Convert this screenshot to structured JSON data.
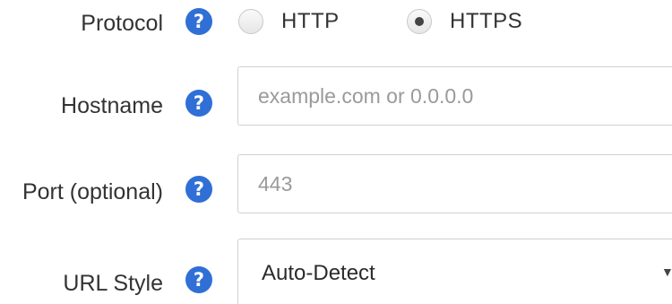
{
  "form": {
    "protocol": {
      "label": "Protocol",
      "help_icon": "question-circle-icon",
      "options": [
        {
          "label": "HTTP",
          "selected": false
        },
        {
          "label": "HTTPS",
          "selected": true
        }
      ]
    },
    "hostname": {
      "label": "Hostname",
      "help_icon": "question-circle-icon",
      "value": "",
      "placeholder": "example.com or 0.0.0.0"
    },
    "port": {
      "label": "Port (optional)",
      "help_icon": "question-circle-icon",
      "value": "",
      "placeholder": "443"
    },
    "url_style": {
      "label": "URL Style",
      "help_icon": "question-circle-icon",
      "selected": "Auto-Detect",
      "caret": "▼"
    },
    "help_glyph": "?"
  },
  "colors": {
    "help_icon_bg": "#2f6fd6",
    "border": "#d0d0d0",
    "placeholder": "#9a9a9a"
  }
}
